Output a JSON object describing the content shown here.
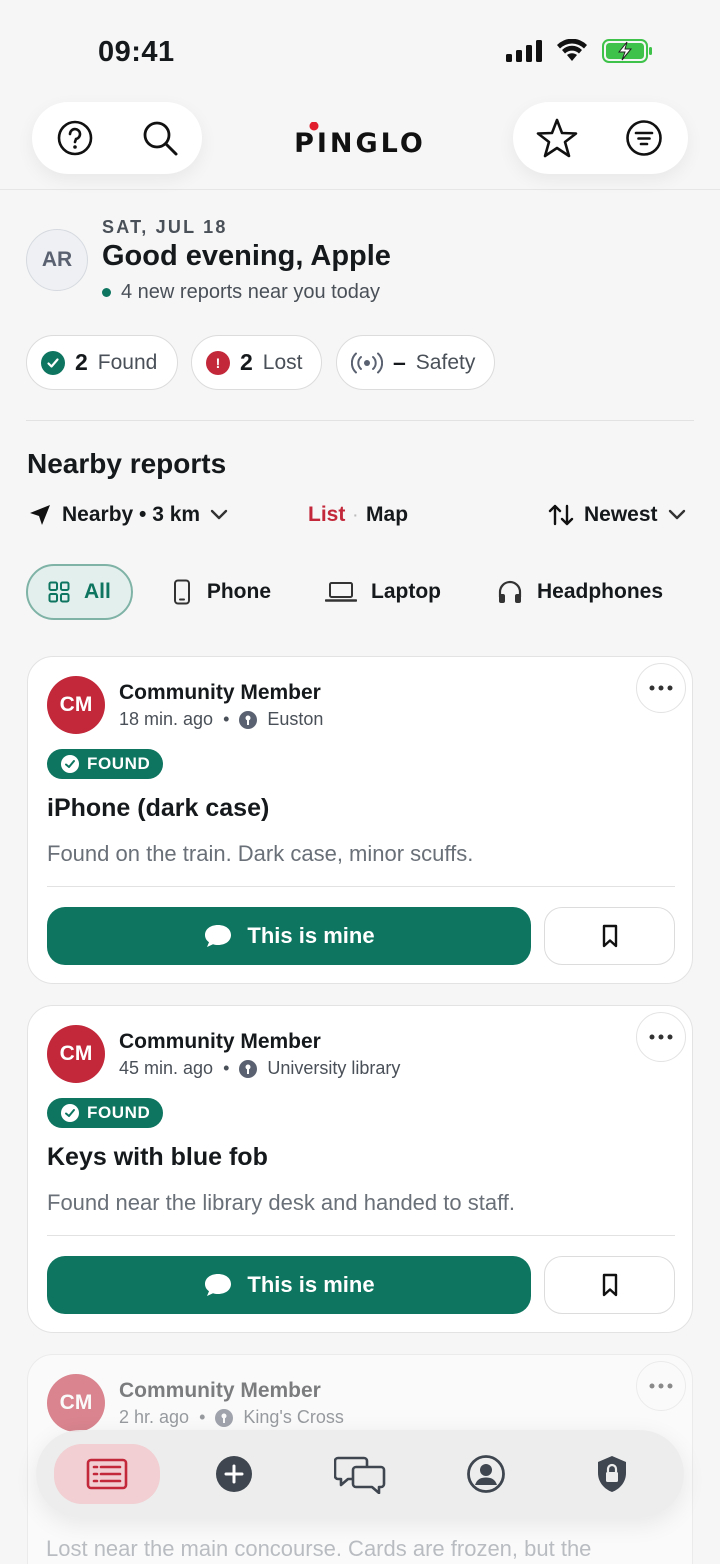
{
  "status_bar": {
    "time": "09:41"
  },
  "header": {
    "logo_text": "PINGLO",
    "accent_color": "#c2283a"
  },
  "user": {
    "initials": "AR"
  },
  "greeting": {
    "date": "SAT, JUL 18",
    "title": "Good evening, Apple",
    "subtitle": "4 new reports near you today"
  },
  "stats": {
    "found": {
      "count": "2",
      "label": "Found"
    },
    "lost": {
      "count": "2",
      "label": "Lost"
    },
    "safety": {
      "count": "–",
      "label": "Safety"
    }
  },
  "section": {
    "title": "Nearby reports"
  },
  "controls": {
    "location": "Nearby • 3 km",
    "view_list": "List",
    "view_map": "Map",
    "sort": "Newest"
  },
  "filters": [
    {
      "label": "All",
      "icon": "grid-icon",
      "active": true
    },
    {
      "label": "Phone",
      "icon": "phone-icon"
    },
    {
      "label": "Laptop",
      "icon": "laptop-icon"
    },
    {
      "label": "Headphones",
      "icon": "headphones-icon"
    }
  ],
  "reports": [
    {
      "initials": "CM",
      "author": "Community Member",
      "time": "18 min. ago",
      "location": "Euston",
      "status": "FOUND",
      "title": "iPhone (dark case)",
      "description": "Found on the train. Dark case, minor scuffs.",
      "action": "This is mine"
    },
    {
      "initials": "CM",
      "author": "Community Member",
      "time": "45 min. ago",
      "location": "University library",
      "status": "FOUND",
      "title": "Keys with blue fob",
      "description": "Found near the library desk and handed to staff.",
      "action": "This is mine"
    },
    {
      "initials": "CM",
      "author": "Community Member",
      "time": "2 hr. ago",
      "location": "King's Cross",
      "description": "Lost near the main concourse. Cards are frozen, but the"
    }
  ],
  "colors": {
    "primary": "#0e7560",
    "danger": "#c2283a",
    "background": "#f6f6f6"
  }
}
